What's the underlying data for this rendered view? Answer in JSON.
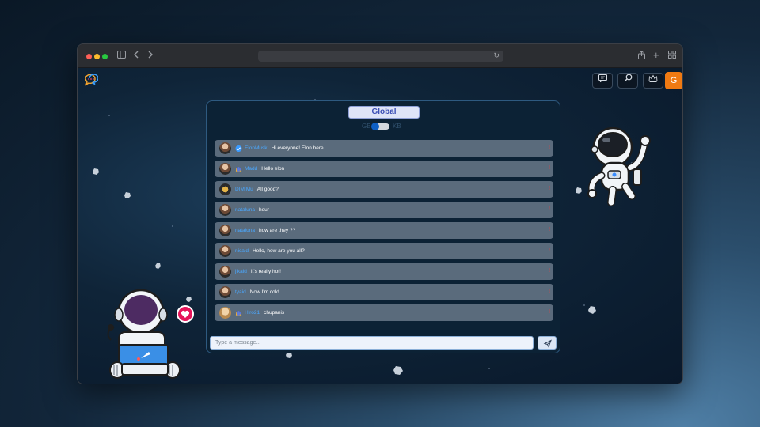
{
  "browser": {
    "url": "",
    "icons": [
      "sidebar-icon",
      "back-icon",
      "forward-icon",
      "reload-icon",
      "share-icon",
      "new-tab-icon",
      "tab-overview-icon"
    ]
  },
  "app": {
    "nav_buttons": [
      "chat-icon",
      "search-icon",
      "crown-icon"
    ],
    "user_initial": "G",
    "accent_color": "#f07a12"
  },
  "chat": {
    "title": "Global",
    "toggle_left": "GB",
    "toggle_right": "KB",
    "input_placeholder": "Type a message...",
    "messages": [
      {
        "user": "ElonMusk",
        "text": "Hi everyone! Elon here",
        "badge": "verified"
      },
      {
        "user": "Madd",
        "text": "Hello elon",
        "badge": "crown"
      },
      {
        "user": "DIMIMu",
        "text": "All good?",
        "badge": ""
      },
      {
        "user": "nataluna",
        "text": "hour",
        "badge": ""
      },
      {
        "user": "nataluna",
        "text": "how are they ??",
        "badge": ""
      },
      {
        "user": "nicaid",
        "text": "Hello, how are you all?",
        "badge": ""
      },
      {
        "user": "jikaid",
        "text": "It's really hot!",
        "badge": ""
      },
      {
        "user": "tyaid",
        "text": "Now I'm cold",
        "badge": ""
      },
      {
        "user": "Hiro21",
        "text": "chupanis",
        "badge": "crown"
      }
    ],
    "report_mark": "!"
  }
}
